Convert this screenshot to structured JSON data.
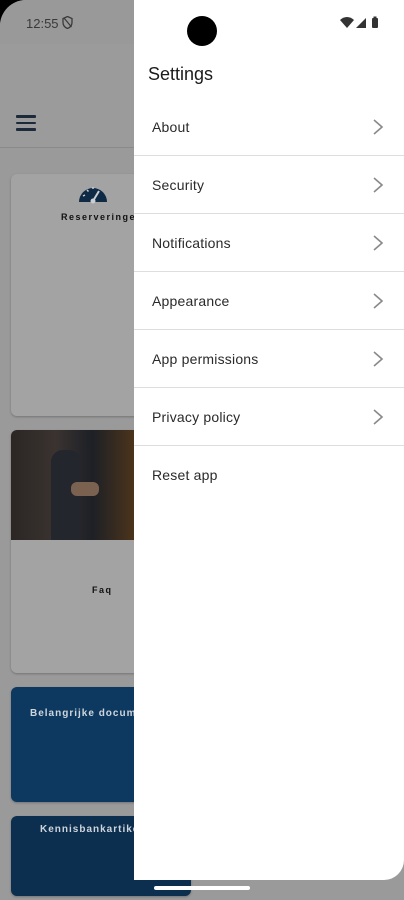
{
  "status_bar": {
    "time": "12:55"
  },
  "background_app": {
    "cards": [
      {
        "title": "Reserveringen"
      },
      {
        "title": "Faq"
      },
      {
        "title": "Belangrijke documenten"
      },
      {
        "title": "Kennisbankartikelen"
      }
    ]
  },
  "drawer": {
    "title": "Settings",
    "items": [
      {
        "label": "About",
        "has_chevron": true
      },
      {
        "label": "Security",
        "has_chevron": true
      },
      {
        "label": "Notifications",
        "has_chevron": true
      },
      {
        "label": "Appearance",
        "has_chevron": true
      },
      {
        "label": "App permissions",
        "has_chevron": true
      },
      {
        "label": "Privacy policy",
        "has_chevron": true
      },
      {
        "label": "Reset app",
        "has_chevron": false
      }
    ]
  },
  "colors": {
    "drawer_bg": "#ffffff",
    "scrim": "#9a9a9a",
    "card_blue": "#0d3960",
    "divider": "#dedede"
  }
}
